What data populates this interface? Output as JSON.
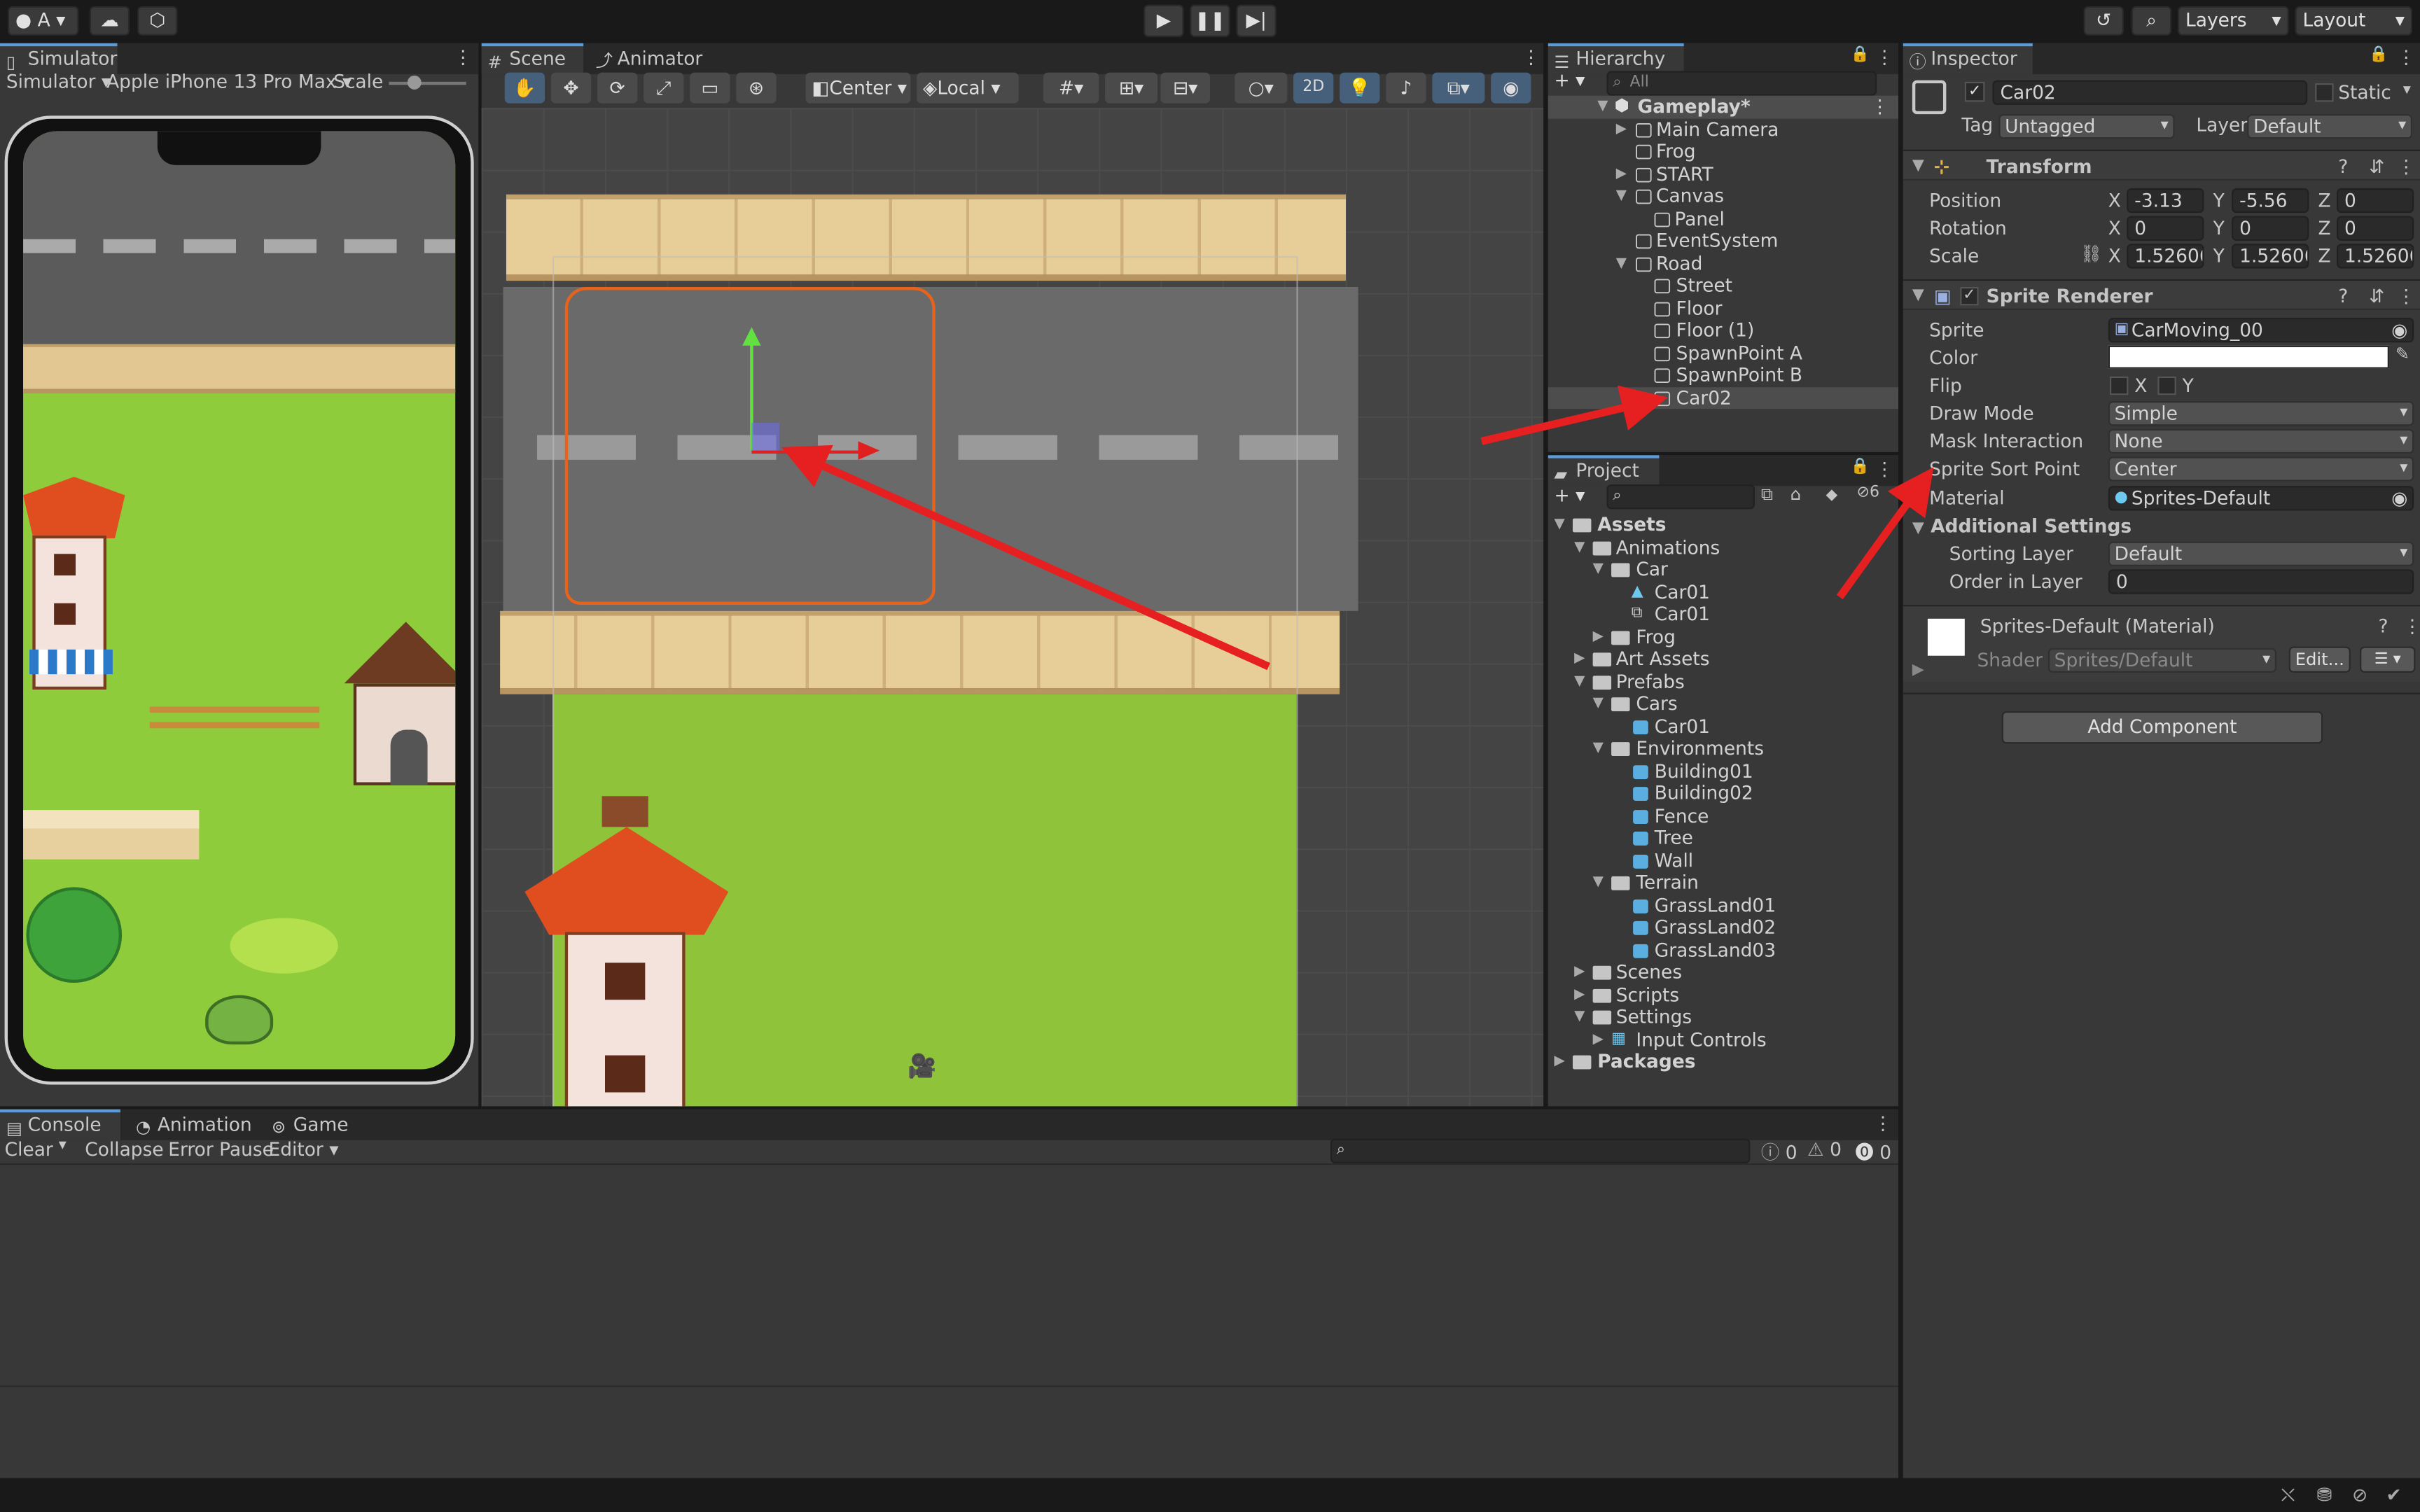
{
  "toolbar": {
    "account": "A",
    "layers": "Layers",
    "layout": "Layout"
  },
  "simulator": {
    "tab": "Simulator",
    "mode": "Simulator",
    "device": "Apple iPhone 13 Pro Max",
    "scale_label": "Scale"
  },
  "scene": {
    "tab_scene": "Scene",
    "tab_animator": "Animator",
    "pivot": "Center",
    "space": "Local",
    "mode_2d": "2D"
  },
  "hierarchy": {
    "tab": "Hierarchy",
    "search_placeholder": "All",
    "items": [
      "Gameplay*",
      "Main Camera",
      "Frog",
      "START",
      "Canvas",
      "Panel",
      "EventSystem",
      "Road",
      "Street",
      "Floor",
      "Floor (1)",
      "SpawnPoint A",
      "SpawnPoint B",
      "Car02"
    ]
  },
  "project": {
    "tab": "Project",
    "hidden_count": "6",
    "items": [
      "Assets",
      "Animations",
      "Car",
      "Car01",
      "Car01",
      "Frog",
      "Art Assets",
      "Prefabs",
      "Cars",
      "Car01",
      "Environments",
      "Building01",
      "Building02",
      "Fence",
      "Tree",
      "Wall",
      "Terrain",
      "GrassLand01",
      "GrassLand02",
      "GrassLand03",
      "Scenes",
      "Scripts",
      "Settings",
      "Input Controls",
      "Packages"
    ]
  },
  "inspector": {
    "tab": "Inspector",
    "object_name": "Car02",
    "static": "Static",
    "tag_label": "Tag",
    "tag": "Untagged",
    "layer_label": "Layer",
    "layer": "Default",
    "transform": {
      "title": "Transform",
      "position": "Position",
      "rotation": "Rotation",
      "scale": "Scale",
      "pos_x": "-3.13",
      "pos_y": "-5.56",
      "pos_z": "0",
      "rot_x": "0",
      "rot_y": "0",
      "rot_z": "0",
      "scale_x": "1.526065",
      "scale_y": "1.526065",
      "scale_z": "1.526065",
      "x": "X",
      "y": "Y",
      "z": "Z"
    },
    "sprite_renderer": {
      "title": "Sprite Renderer",
      "sprite_label": "Sprite",
      "sprite": "CarMoving_00",
      "color_label": "Color",
      "flip_label": "Flip",
      "flip_x": "X",
      "flip_y": "Y",
      "draw_mode_label": "Draw Mode",
      "draw_mode": "Simple",
      "mask_label": "Mask Interaction",
      "mask": "None",
      "sort_point_label": "Sprite Sort Point",
      "sort_point": "Center",
      "material_label": "Material",
      "material": "Sprites-Default",
      "additional": "Additional Settings",
      "sorting_layer_label": "Sorting Layer",
      "sorting_layer": "Default",
      "order_label": "Order in Layer",
      "order": "0"
    },
    "material": {
      "title": "Sprites-Default (Material)",
      "shader_label": "Shader",
      "shader": "Sprites/Default",
      "edit": "Edit..."
    },
    "add_component": "Add Component"
  },
  "console": {
    "tab_console": "Console",
    "tab_animation": "Animation",
    "tab_game": "Game",
    "clear": "Clear",
    "collapse": "Collapse",
    "error_pause": "Error Pause",
    "editor": "Editor",
    "log_count": "0",
    "warn_count": "0",
    "error_count": "0"
  },
  "colors": {
    "arrow": "#e62020",
    "accent": "#5c9bd6",
    "selection": "#2c5d87"
  }
}
